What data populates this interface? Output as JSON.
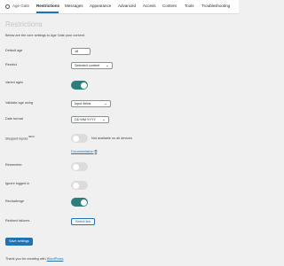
{
  "app": {
    "name": "Age Gate",
    "tabs": [
      {
        "label": "Restrictions",
        "active": true
      },
      {
        "label": "Messages"
      },
      {
        "label": "Appearance"
      },
      {
        "label": "Advanced"
      },
      {
        "label": "Access"
      },
      {
        "label": "Content"
      },
      {
        "label": "Tools"
      },
      {
        "label": "Troubleshooting"
      }
    ]
  },
  "page": {
    "title": "Restrictions",
    "description": "Below are the core settings to Age Gate your content."
  },
  "form": {
    "default_age": {
      "label": "Default age",
      "value": "18"
    },
    "restrict": {
      "label": "Restrict",
      "value": "Selected content"
    },
    "varied_ages": {
      "label": "Varied ages",
      "on": true
    },
    "validate_age_using": {
      "label": "Validate age using",
      "value": "Input fields"
    },
    "date_format": {
      "label": "Date format",
      "value": "DD MM YYYY"
    },
    "stepped_inputs": {
      "label": "Stepped inputs",
      "badge": "BETA",
      "on": false,
      "note": "Not available on all devices",
      "link": "Documentation"
    },
    "remember": {
      "label": "Remember",
      "on": false
    },
    "ignore_logged_in": {
      "label": "Ignore logged in",
      "on": false
    },
    "rechallenge": {
      "label": "Rechallenge",
      "on": true
    },
    "redirect_failures": {
      "label": "Redirect failures",
      "button": "Select link"
    }
  },
  "actions": {
    "save": "Save settings"
  },
  "footer": {
    "prefix": "Thank you for creating with ",
    "link": "WordPress",
    "suffix": "."
  },
  "colors": {
    "accent": "#2271b1",
    "toggle_on": "#2f7d7a",
    "toggle_off": "#dcdcde",
    "background": "#f0f0f1"
  },
  "icons": {
    "logo": "age-gate-logo-icon",
    "dropdown": "chevron-down-icon",
    "external": "external-link-icon"
  }
}
